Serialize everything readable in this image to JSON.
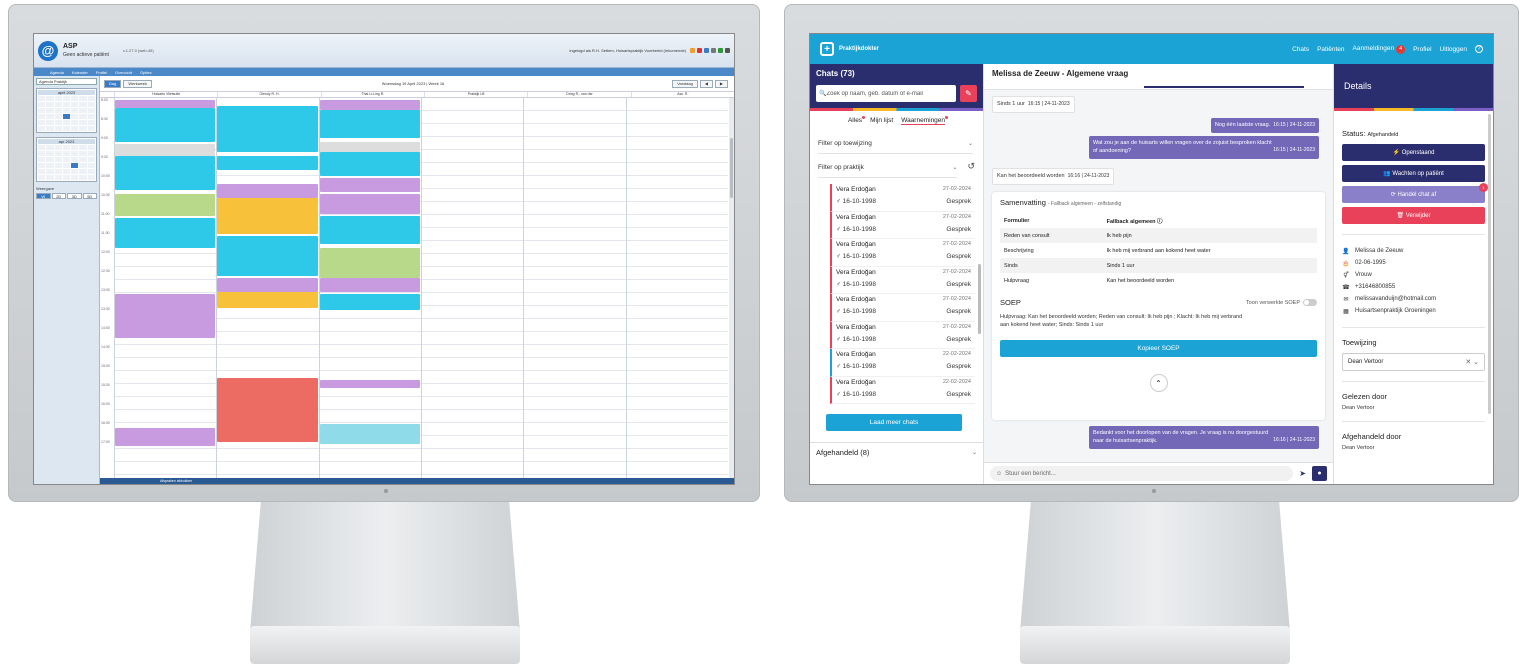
{
  "left_app": {
    "title": "ASP",
    "subtitle": "Geen actieve patiënt",
    "version": "v.1.27.0 (web-45)",
    "user_info": "ingelogd als R.H. Settem, Huisartspraktijk Voorbeeld (Inkomende)",
    "menu": [
      "Agenda",
      "Kalender",
      "Profiel",
      "Overzicht",
      "Opties"
    ],
    "agenda_select": "Agenda Praktijk",
    "cal1_head": "april 2023",
    "cal2_head": "apr 2023",
    "weergave_label": "Weergave",
    "weergave_opts": [
      "W",
      "2D",
      "3D",
      "5D"
    ],
    "view_dag": "Dag",
    "view_werkweek": "Werkweek",
    "date_label": "Woensdag 19 April 2023 | Week 16",
    "vandaag": "Vandaag",
    "columns": [
      "Huisarts Vlietsuite",
      "Gieruly R. H.",
      "Thai Li-Ling R.",
      "Praktijk LB",
      "Dring R., van der",
      "Ass. R."
    ],
    "times": [
      "8:00",
      "8:30",
      "9:00",
      "9:30",
      "10:00",
      "10:30",
      "11:00",
      "11:30",
      "12:00",
      "12:30",
      "13:00",
      "13:30",
      "14:00",
      "14:30",
      "15:00",
      "15:30",
      "16:00",
      "16:30",
      "17:00"
    ],
    "status_text": "Afspraken afdrukken"
  },
  "right_app": {
    "brand": "Praktijkdokter",
    "nav": {
      "chats": "Chats",
      "patienten": "Patiënten",
      "aanmeldingen": "Aanmeldingen",
      "aanmeldingen_count": "4",
      "profiel": "Profiel",
      "uitloggen": "Uitloggen"
    },
    "chats_title": "Chats (73)",
    "search_placeholder": "Zoek op naam, geb. datum of e-mail",
    "tabs": [
      "Alles",
      "Mijn lijst",
      "Waarnemingen"
    ],
    "filter_toewijzing": "Filter op toewijzing",
    "filter_praktijk": "Filter op praktijk",
    "chat_items": [
      {
        "name": "Vera Erdoğan",
        "dob": "♂ 16-10-1998",
        "date": "27-02-2024",
        "type": "Gesprek",
        "color": "red"
      },
      {
        "name": "Vera Erdoğan",
        "dob": "♂ 16-10-1998",
        "date": "27-02-2024",
        "type": "Gesprek",
        "color": "red"
      },
      {
        "name": "Vera Erdoğan",
        "dob": "♂ 16-10-1998",
        "date": "27-02-2024",
        "type": "Gesprek",
        "color": "red"
      },
      {
        "name": "Vera Erdoğan",
        "dob": "♂ 16-10-1998",
        "date": "27-02-2024",
        "type": "Gesprek",
        "color": "red"
      },
      {
        "name": "Vera Erdoğan",
        "dob": "♂ 16-10-1998",
        "date": "27-02-2024",
        "type": "Gesprek",
        "color": "red"
      },
      {
        "name": "Vera Erdoğan",
        "dob": "♂ 16-10-1998",
        "date": "27-02-2024",
        "type": "Gesprek",
        "color": "red"
      },
      {
        "name": "Vera Erdoğan",
        "dob": "♂ 16-10-1998",
        "date": "22-02-2024",
        "type": "Gesprek",
        "color": "blue"
      },
      {
        "name": "Vera Erdoğan",
        "dob": "♂ 16-10-1998",
        "date": "22-02-2024",
        "type": "Gesprek",
        "color": "red"
      }
    ],
    "load_more": "Laad meer chats",
    "afgehandeld": "Afgehandeld (8)",
    "conversation_title": "Melissa de Zeeuw - Algemene vraag",
    "messages": {
      "m1": "Sinds 1 uur",
      "m1_ts": "16:15 | 24-11-2023",
      "m2": "Nog één laatste vraag.",
      "m2_ts": "16:15 | 24-11-2023",
      "m3a": "Wat zou je aan de huisarts willen vragen over de zojuist besproken klacht",
      "m3b": "of aandoening?",
      "m3_ts": "16:15 | 24-11-2023",
      "m4": "Kan het beoordeeld worden",
      "m4_ts": "16:16 | 24-11-2023",
      "m5a": "Bedankt voor het doorlopen van de vragen. Je vraag is nu doorgestuurd",
      "m5b": "naar de huisartsenpraktijk.",
      "m5_ts": "16:16 | 24-11-2023"
    },
    "summary": {
      "title": "Samenvatting",
      "title_sub": "- Fallback algemeen - zelfstandig",
      "head_left": "Formulier",
      "head_right": "Fallback algemeen ⓘ",
      "rows": [
        {
          "k": "Reden van consult",
          "v": "Ik heb pijn"
        },
        {
          "k": "Beschrijving",
          "v": "Ik heb mij verbrand aan kokend heet water"
        },
        {
          "k": "Sinds",
          "v": "Sinds 1 uur"
        },
        {
          "k": "Hulpvraag",
          "v": "Kan het beoordeeld worden"
        }
      ],
      "soep_title": "SOEP",
      "soep_toggle": "Toon verwerkte SOEP",
      "soep_text_a": "Hulpvraag: Kan het beoordeeld worden; Reden van consult: Ik heb pijn ; Klacht: Ik heb mij verbrand",
      "soep_text_b": "aan kokend heet water; Sinds: Sinds 1 uur",
      "copy": "Kopieer SOEP"
    },
    "compose_placeholder": "Stuur een bericht...",
    "details": {
      "title": "Details",
      "status_label": "Status:",
      "status_value": "Afgehandeld",
      "btn_open": "⚡ Openstaand",
      "btn_wait": "👥 Wachten op patiënt",
      "btn_handle": "⟳ Handel chat af",
      "btn_delete": "🗑 Verwijder",
      "handle_badge": "1",
      "name": "Melissa de Zeeuw",
      "dob": "02-06-1995",
      "gender": "Vrouw",
      "phone": "+31646800855",
      "email": "melissavanduijn@hotmail.com",
      "practice": "Huisartsenpraktijk Groeningen",
      "toewijzing_label": "Toewijzing",
      "toewijzing_value": "Dean Vertoor",
      "gelezen_label": "Gelezen door",
      "gelezen_value": "Dean Vertoor",
      "afgehandeld_label": "Afgehandeld door",
      "afgehandeld_value": "Dean Vertoor"
    },
    "colors": {
      "nav": "#1aa3d4",
      "navy": "#2b2e6e",
      "accent": "#e9415a",
      "purple": "#7367b8",
      "btn_handle": "#8a7fc9",
      "btn_delete": "#e9415a"
    }
  }
}
